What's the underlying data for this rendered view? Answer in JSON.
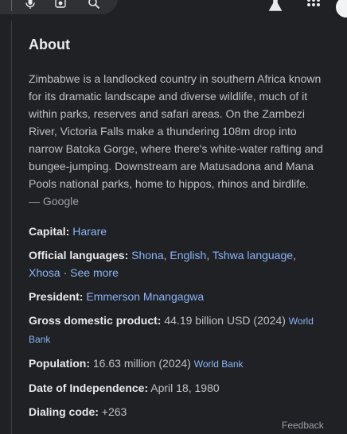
{
  "header": {
    "icons": [
      "mic-icon",
      "camera-search-icon",
      "search-icon",
      "flask-icon",
      "apps-grid-icon",
      "avatar"
    ]
  },
  "about": {
    "title": "About",
    "description": "Zimbabwe is a landlocked country in southern Africa known for its dramatic landscape and diverse wildlife, much of it within parks, reserves and safari areas. On the Zambezi River, Victoria Falls make a thundering 108m drop into narrow Batoka Gorge, where there's white-water rafting and bungee-jumping. Downstream are Matusadona and Mana Pools national parks, home to hippos, rhinos and birdlife.",
    "source": "— Google"
  },
  "facts": {
    "capital": {
      "label": "Capital:",
      "value": "Harare"
    },
    "languages": {
      "label": "Official languages:",
      "items": [
        "Shona",
        "English",
        "Tshwa language",
        "Xhosa"
      ],
      "comma": ",",
      "dot": "·",
      "see_more": "See more"
    },
    "president": {
      "label": "President:",
      "value": "Emmerson Mnangagwa"
    },
    "gdp": {
      "label": "Gross domestic product:",
      "value": "44.19 billion USD (2024)",
      "source": "World Bank"
    },
    "population": {
      "label": "Population:",
      "value": "16.63 million (2024)",
      "source": "World Bank"
    },
    "independence": {
      "label": "Date of Independence:",
      "value": "April 18, 1980"
    },
    "dialing": {
      "label": "Dialing code:",
      "value": "+263"
    }
  },
  "footer": {
    "feedback": "Feedback"
  },
  "colors": {
    "background": "#202124",
    "link": "#8ab4f8",
    "text": "#bdc1c6",
    "heading": "#e8eaed"
  }
}
